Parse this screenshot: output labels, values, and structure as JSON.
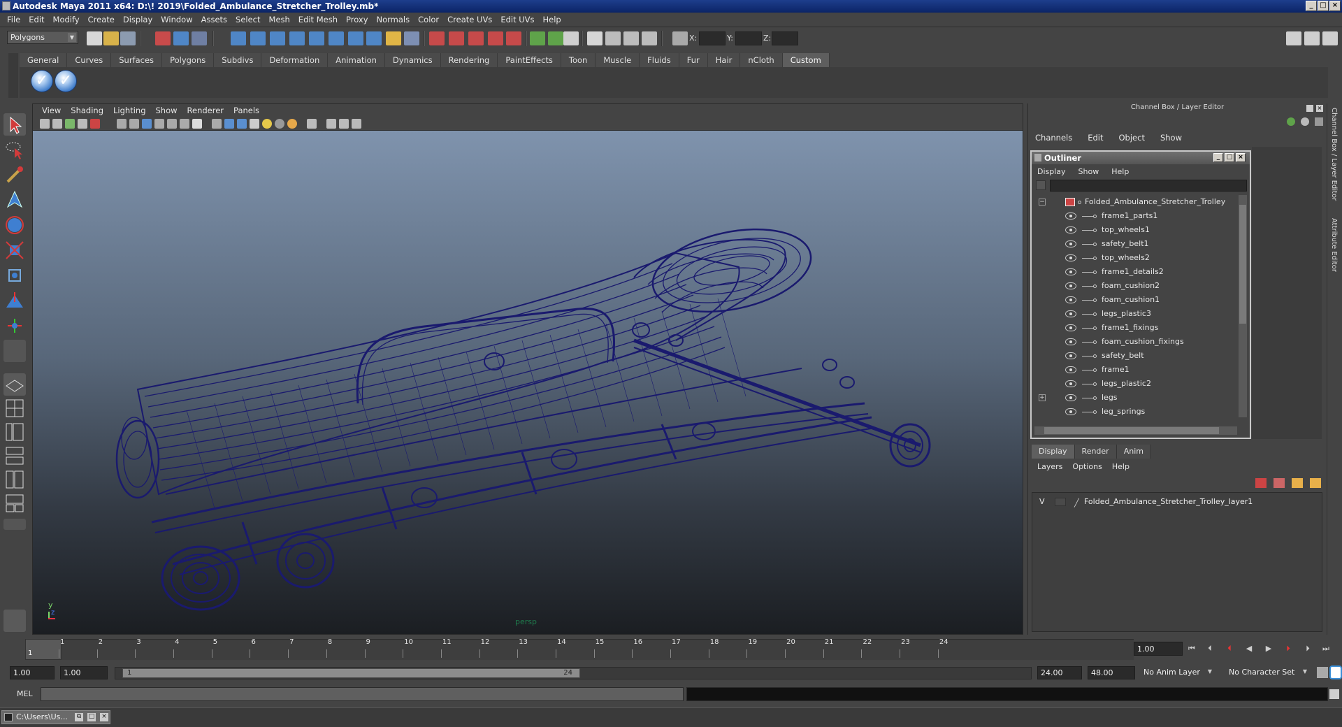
{
  "window": {
    "title": "Autodesk Maya 2011 x64: D:\\! 2019\\Folded_Ambulance_Stretcher_Trolley.mb*"
  },
  "menubar": [
    "File",
    "Edit",
    "Modify",
    "Create",
    "Display",
    "Window",
    "Assets",
    "Select",
    "Mesh",
    "Edit Mesh",
    "Proxy",
    "Normals",
    "Color",
    "Create UVs",
    "Edit UVs",
    "Help"
  ],
  "statusline": {
    "mode": "Polygons",
    "x_label": "X:",
    "y_label": "Y:",
    "z_label": "Z:"
  },
  "shelf": {
    "tabs": [
      "General",
      "Curves",
      "Surfaces",
      "Polygons",
      "Subdivs",
      "Deformation",
      "Animation",
      "Dynamics",
      "Rendering",
      "PaintEffects",
      "Toon",
      "Muscle",
      "Fluids",
      "Fur",
      "Hair",
      "nCloth",
      "Custom"
    ],
    "active_tab": "Custom",
    "buttons": [
      "check-icon",
      "check-icon"
    ]
  },
  "viewport": {
    "menus": [
      "View",
      "Shading",
      "Lighting",
      "Show",
      "Renderer",
      "Panels"
    ],
    "camera_label": "persp",
    "axis_y": "y",
    "axis_z": "z",
    "wire_color": "#1a1a6e",
    "bg_top": "#7f93ad",
    "bg_bottom": "#1b1e22"
  },
  "channel_box": {
    "header": "Channel Box / Layer Editor",
    "menus": [
      "Channels",
      "Edit",
      "Object",
      "Show"
    ]
  },
  "outliner": {
    "title": "Outliner",
    "menus": [
      "Display",
      "Show",
      "Help"
    ],
    "root": "Folded_Ambulance_Stretcher_Trolley",
    "items": [
      "frame1_parts1",
      "top_wheels1",
      "safety_belt1",
      "top_wheels2",
      "frame1_details2",
      "foam_cushion2",
      "foam_cushion1",
      "legs_plastic3",
      "frame1_fixings",
      "foam_cushion_fixings",
      "safety_belt",
      "frame1",
      "legs_plastic2",
      "legs",
      "leg_springs"
    ],
    "expandable": "legs"
  },
  "layer_editor": {
    "tabs": [
      "Display",
      "Render",
      "Anim"
    ],
    "active_tab": "Display",
    "menus": [
      "Layers",
      "Options",
      "Help"
    ],
    "layer": {
      "visible": "V",
      "name": "Folded_Ambulance_Stretcher_Trolley_layer1"
    }
  },
  "sidestrip": {
    "label1": "Channel Box / Layer Editor",
    "label2": "Attribute Editor"
  },
  "timeline": {
    "ticks": [
      "1",
      "2",
      "3",
      "4",
      "5",
      "6",
      "7",
      "8",
      "9",
      "10",
      "11",
      "12",
      "13",
      "14",
      "15",
      "16",
      "17",
      "18",
      "19",
      "20",
      "21",
      "22",
      "23",
      "24"
    ],
    "current_in_slider": "1",
    "current_frame": "1.00"
  },
  "range": {
    "start_time": "1.00",
    "start_range": "1.00",
    "range_in": "1",
    "range_out": "24",
    "end_range": "24.00",
    "end_time": "48.00",
    "anim_layer": "No Anim Layer",
    "character_set": "No Character Set"
  },
  "command": {
    "label": "MEL"
  },
  "taskbar": {
    "item": "C:\\Users\\Us..."
  }
}
